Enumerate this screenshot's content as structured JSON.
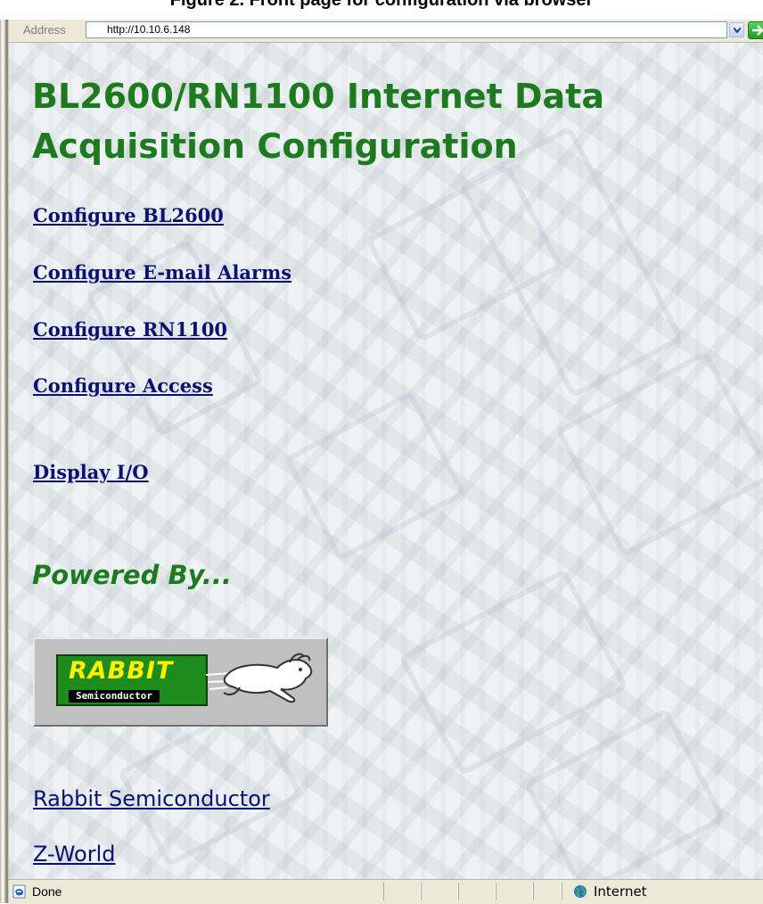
{
  "caption": "Figure 2. Front page for configuration via browser",
  "address_bar": {
    "label": "Address",
    "url": "http://10.10.6.148"
  },
  "page": {
    "title": "BL2600/RN1100 Internet Data Acquisition Configuration",
    "links": [
      {
        "label": "Configure BL2600"
      },
      {
        "label": "Configure E-mail Alarms"
      },
      {
        "label": "Configure RN1100"
      },
      {
        "label": "Configure Access"
      },
      {
        "label": "Display I/O"
      }
    ],
    "powered_by": "Powered By...",
    "logo": {
      "word": "RABBIT",
      "sub": "Semiconductor",
      "icon": "rabbit-semiconductor-logo"
    },
    "external_links": [
      {
        "label": "Rabbit Semiconductor"
      },
      {
        "label": "Z-World"
      }
    ]
  },
  "status_bar": {
    "status": "Done",
    "zone": "Internet",
    "icons": [
      "ie-page-icon",
      "globe-icon"
    ]
  },
  "colors": {
    "title_green": "#1e7a1e",
    "link_blue": "#0b1173",
    "logo_green": "#1d8c1d",
    "logo_yellow": "#fff200"
  }
}
